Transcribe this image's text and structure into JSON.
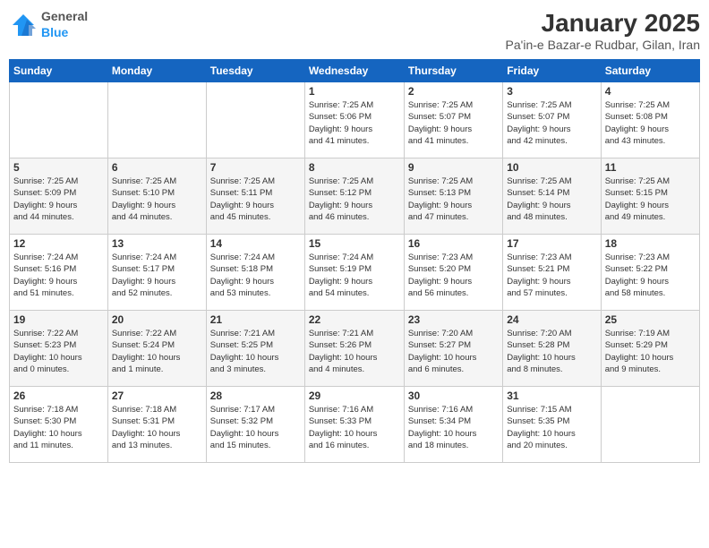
{
  "logo": {
    "general": "General",
    "blue": "Blue"
  },
  "title": "January 2025",
  "subtitle": "Pa'in-e Bazar-e Rudbar, Gilan, Iran",
  "days_header": [
    "Sunday",
    "Monday",
    "Tuesday",
    "Wednesday",
    "Thursday",
    "Friday",
    "Saturday"
  ],
  "weeks": [
    [
      {
        "day": "",
        "info": ""
      },
      {
        "day": "",
        "info": ""
      },
      {
        "day": "",
        "info": ""
      },
      {
        "day": "1",
        "info": "Sunrise: 7:25 AM\nSunset: 5:06 PM\nDaylight: 9 hours\nand 41 minutes."
      },
      {
        "day": "2",
        "info": "Sunrise: 7:25 AM\nSunset: 5:07 PM\nDaylight: 9 hours\nand 41 minutes."
      },
      {
        "day": "3",
        "info": "Sunrise: 7:25 AM\nSunset: 5:07 PM\nDaylight: 9 hours\nand 42 minutes."
      },
      {
        "day": "4",
        "info": "Sunrise: 7:25 AM\nSunset: 5:08 PM\nDaylight: 9 hours\nand 43 minutes."
      }
    ],
    [
      {
        "day": "5",
        "info": "Sunrise: 7:25 AM\nSunset: 5:09 PM\nDaylight: 9 hours\nand 44 minutes."
      },
      {
        "day": "6",
        "info": "Sunrise: 7:25 AM\nSunset: 5:10 PM\nDaylight: 9 hours\nand 44 minutes."
      },
      {
        "day": "7",
        "info": "Sunrise: 7:25 AM\nSunset: 5:11 PM\nDaylight: 9 hours\nand 45 minutes."
      },
      {
        "day": "8",
        "info": "Sunrise: 7:25 AM\nSunset: 5:12 PM\nDaylight: 9 hours\nand 46 minutes."
      },
      {
        "day": "9",
        "info": "Sunrise: 7:25 AM\nSunset: 5:13 PM\nDaylight: 9 hours\nand 47 minutes."
      },
      {
        "day": "10",
        "info": "Sunrise: 7:25 AM\nSunset: 5:14 PM\nDaylight: 9 hours\nand 48 minutes."
      },
      {
        "day": "11",
        "info": "Sunrise: 7:25 AM\nSunset: 5:15 PM\nDaylight: 9 hours\nand 49 minutes."
      }
    ],
    [
      {
        "day": "12",
        "info": "Sunrise: 7:24 AM\nSunset: 5:16 PM\nDaylight: 9 hours\nand 51 minutes."
      },
      {
        "day": "13",
        "info": "Sunrise: 7:24 AM\nSunset: 5:17 PM\nDaylight: 9 hours\nand 52 minutes."
      },
      {
        "day": "14",
        "info": "Sunrise: 7:24 AM\nSunset: 5:18 PM\nDaylight: 9 hours\nand 53 minutes."
      },
      {
        "day": "15",
        "info": "Sunrise: 7:24 AM\nSunset: 5:19 PM\nDaylight: 9 hours\nand 54 minutes."
      },
      {
        "day": "16",
        "info": "Sunrise: 7:23 AM\nSunset: 5:20 PM\nDaylight: 9 hours\nand 56 minutes."
      },
      {
        "day": "17",
        "info": "Sunrise: 7:23 AM\nSunset: 5:21 PM\nDaylight: 9 hours\nand 57 minutes."
      },
      {
        "day": "18",
        "info": "Sunrise: 7:23 AM\nSunset: 5:22 PM\nDaylight: 9 hours\nand 58 minutes."
      }
    ],
    [
      {
        "day": "19",
        "info": "Sunrise: 7:22 AM\nSunset: 5:23 PM\nDaylight: 10 hours\nand 0 minutes."
      },
      {
        "day": "20",
        "info": "Sunrise: 7:22 AM\nSunset: 5:24 PM\nDaylight: 10 hours\nand 1 minute."
      },
      {
        "day": "21",
        "info": "Sunrise: 7:21 AM\nSunset: 5:25 PM\nDaylight: 10 hours\nand 3 minutes."
      },
      {
        "day": "22",
        "info": "Sunrise: 7:21 AM\nSunset: 5:26 PM\nDaylight: 10 hours\nand 4 minutes."
      },
      {
        "day": "23",
        "info": "Sunrise: 7:20 AM\nSunset: 5:27 PM\nDaylight: 10 hours\nand 6 minutes."
      },
      {
        "day": "24",
        "info": "Sunrise: 7:20 AM\nSunset: 5:28 PM\nDaylight: 10 hours\nand 8 minutes."
      },
      {
        "day": "25",
        "info": "Sunrise: 7:19 AM\nSunset: 5:29 PM\nDaylight: 10 hours\nand 9 minutes."
      }
    ],
    [
      {
        "day": "26",
        "info": "Sunrise: 7:18 AM\nSunset: 5:30 PM\nDaylight: 10 hours\nand 11 minutes."
      },
      {
        "day": "27",
        "info": "Sunrise: 7:18 AM\nSunset: 5:31 PM\nDaylight: 10 hours\nand 13 minutes."
      },
      {
        "day": "28",
        "info": "Sunrise: 7:17 AM\nSunset: 5:32 PM\nDaylight: 10 hours\nand 15 minutes."
      },
      {
        "day": "29",
        "info": "Sunrise: 7:16 AM\nSunset: 5:33 PM\nDaylight: 10 hours\nand 16 minutes."
      },
      {
        "day": "30",
        "info": "Sunrise: 7:16 AM\nSunset: 5:34 PM\nDaylight: 10 hours\nand 18 minutes."
      },
      {
        "day": "31",
        "info": "Sunrise: 7:15 AM\nSunset: 5:35 PM\nDaylight: 10 hours\nand 20 minutes."
      },
      {
        "day": "",
        "info": ""
      }
    ]
  ]
}
